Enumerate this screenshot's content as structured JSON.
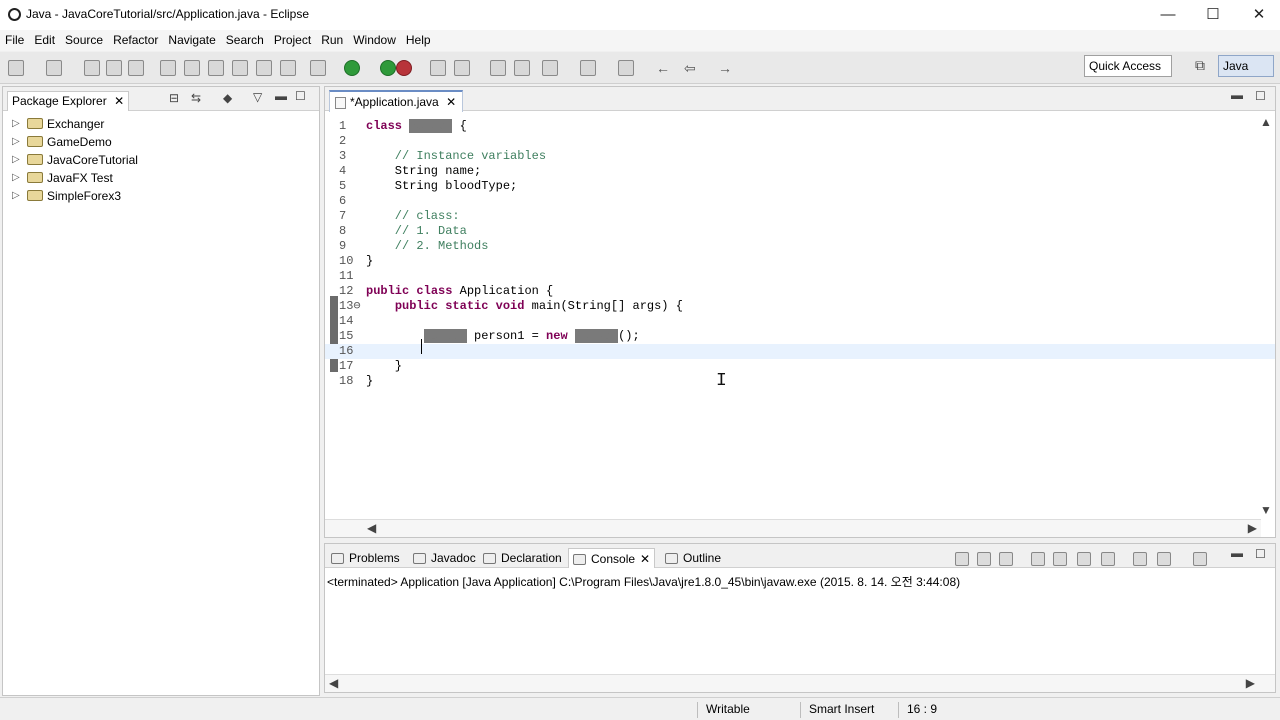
{
  "window": {
    "title": "Java - JavaCoreTutorial/src/Application.java - Eclipse",
    "controls": {
      "minimize": "—",
      "maximize": "☐",
      "close": "✕"
    }
  },
  "menubar": {
    "items": [
      "File",
      "Edit",
      "Source",
      "Refactor",
      "Navigate",
      "Search",
      "Project",
      "Run",
      "Window",
      "Help"
    ]
  },
  "toolbar": {
    "quick_access": "Quick Access",
    "perspective": "Java"
  },
  "package_explorer": {
    "tab_label": "Package Explorer",
    "projects": [
      "Exchanger",
      "GameDemo",
      "JavaCoreTutorial",
      "JavaFX Test",
      "SimpleForex3"
    ]
  },
  "editor": {
    "tab_label": "*Application.java",
    "lines": [
      {
        "n": "1",
        "text": "class Person {"
      },
      {
        "n": "2",
        "text": ""
      },
      {
        "n": "3",
        "text": "    // Instance variables"
      },
      {
        "n": "4",
        "text": "    String name;"
      },
      {
        "n": "5",
        "text": "    String bloodType;"
      },
      {
        "n": "6",
        "text": ""
      },
      {
        "n": "7",
        "text": "    // class:"
      },
      {
        "n": "8",
        "text": "    // 1. Data"
      },
      {
        "n": "9",
        "text": "    // 2. Methods"
      },
      {
        "n": "10",
        "text": "}"
      },
      {
        "n": "11",
        "text": ""
      },
      {
        "n": "12",
        "text": "public class Application {"
      },
      {
        "n": "13⊖",
        "text": "    public static void main(String[] args) {"
      },
      {
        "n": "14",
        "text": ""
      },
      {
        "n": "15",
        "text": "        Person person1 = new Person();"
      },
      {
        "n": "16",
        "text": ""
      },
      {
        "n": "17",
        "text": "    }"
      },
      {
        "n": "18",
        "text": "}"
      }
    ]
  },
  "bottom_panel": {
    "tabs": [
      "Problems",
      "Javadoc",
      "Declaration",
      "Console",
      "Outline"
    ],
    "active_tab": "Console",
    "console_status": "<terminated> Application [Java Application] C:\\Program Files\\Java\\jre1.8.0_45\\bin\\javaw.exe (2015. 8. 14. 오전 3:44:08)"
  },
  "statusbar": {
    "writable": "Writable",
    "insert_mode": "Smart Insert",
    "position": "16 : 9"
  }
}
